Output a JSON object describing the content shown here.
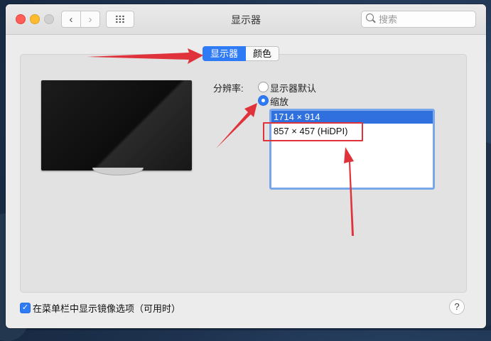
{
  "window": {
    "title": "显示器",
    "search_placeholder": "搜索"
  },
  "toolbar": {
    "back_glyph": "‹",
    "forward_glyph": "›"
  },
  "tabs": [
    {
      "label": "显示器",
      "active": true
    },
    {
      "label": "颜色",
      "active": false
    }
  ],
  "resolution": {
    "label": "分辨率:",
    "options": [
      {
        "label": "显示器默认",
        "selected": false
      },
      {
        "label": "缩放",
        "selected": true
      }
    ],
    "list": [
      {
        "label": "1714 × 914",
        "selected": true
      },
      {
        "label": "857 × 457 (HiDPI)",
        "selected": false
      }
    ]
  },
  "footer": {
    "mirror_option_label": "在菜单栏中显示镜像选项（可用时）",
    "mirror_option_checked": true,
    "help_label": "?"
  },
  "colors": {
    "accent": "#2f7bf5",
    "annotation": "#e0323a"
  },
  "icons": [
    "search-icon",
    "grid-icon",
    "monitor-image",
    "checkmark-icon",
    "help-icon"
  ]
}
